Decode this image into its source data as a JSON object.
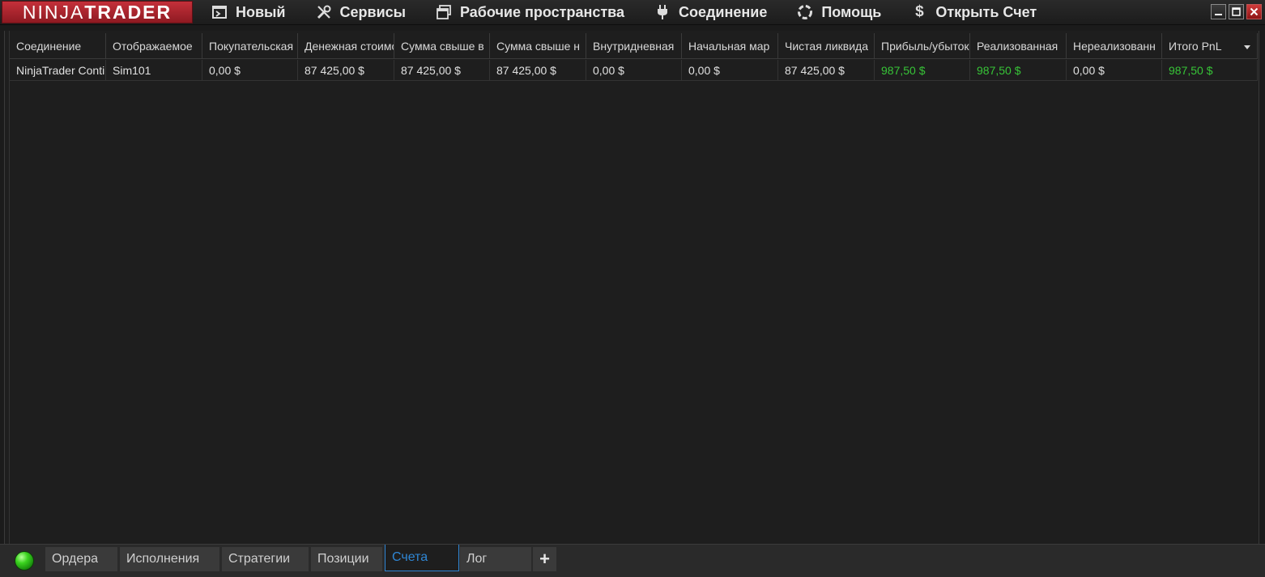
{
  "app": {
    "logo_part1": "NINJA",
    "logo_part2": "TRADER"
  },
  "menu": [
    {
      "label": "Новый",
      "icon": "new-window-icon"
    },
    {
      "label": "Сервисы",
      "icon": "tools-icon"
    },
    {
      "label": "Рабочие пространства",
      "icon": "workspaces-icon"
    },
    {
      "label": "Соединение",
      "icon": "plug-icon"
    },
    {
      "label": "Помощь",
      "icon": "lifebuoy-icon"
    },
    {
      "label": "Открыть Счет",
      "icon": "dollar-icon"
    }
  ],
  "grid": {
    "columns": [
      "Соединение",
      "Отображаемое",
      "Покупательская",
      "Денежная стоимость",
      "Сумма свыше в",
      "Сумма свыше н",
      "Внутридневная",
      "Начальная мар",
      "Чистая ликвида",
      "Прибыль/убыток",
      "Реализованная",
      "Нереализованн",
      "Итого PnL"
    ],
    "rows": [
      [
        "NinjaTrader Continuum",
        "Sim101",
        "0,00 $",
        "87 425,00 $",
        "87 425,00 $",
        "87 425,00 $",
        "0,00 $",
        "0,00 $",
        "87 425,00 $",
        "987,50 $",
        "987,50 $",
        "0,00 $",
        "987,50 $"
      ]
    ],
    "positive_color": "#37c437"
  },
  "tabs": [
    {
      "label": "Ордера"
    },
    {
      "label": "Исполнения"
    },
    {
      "label": "Стратегии"
    },
    {
      "label": "Позиции"
    },
    {
      "label": "Счета",
      "active": true
    },
    {
      "label": "Лог"
    }
  ],
  "tab_add_label": "+",
  "status": {
    "connection_color": "green"
  }
}
